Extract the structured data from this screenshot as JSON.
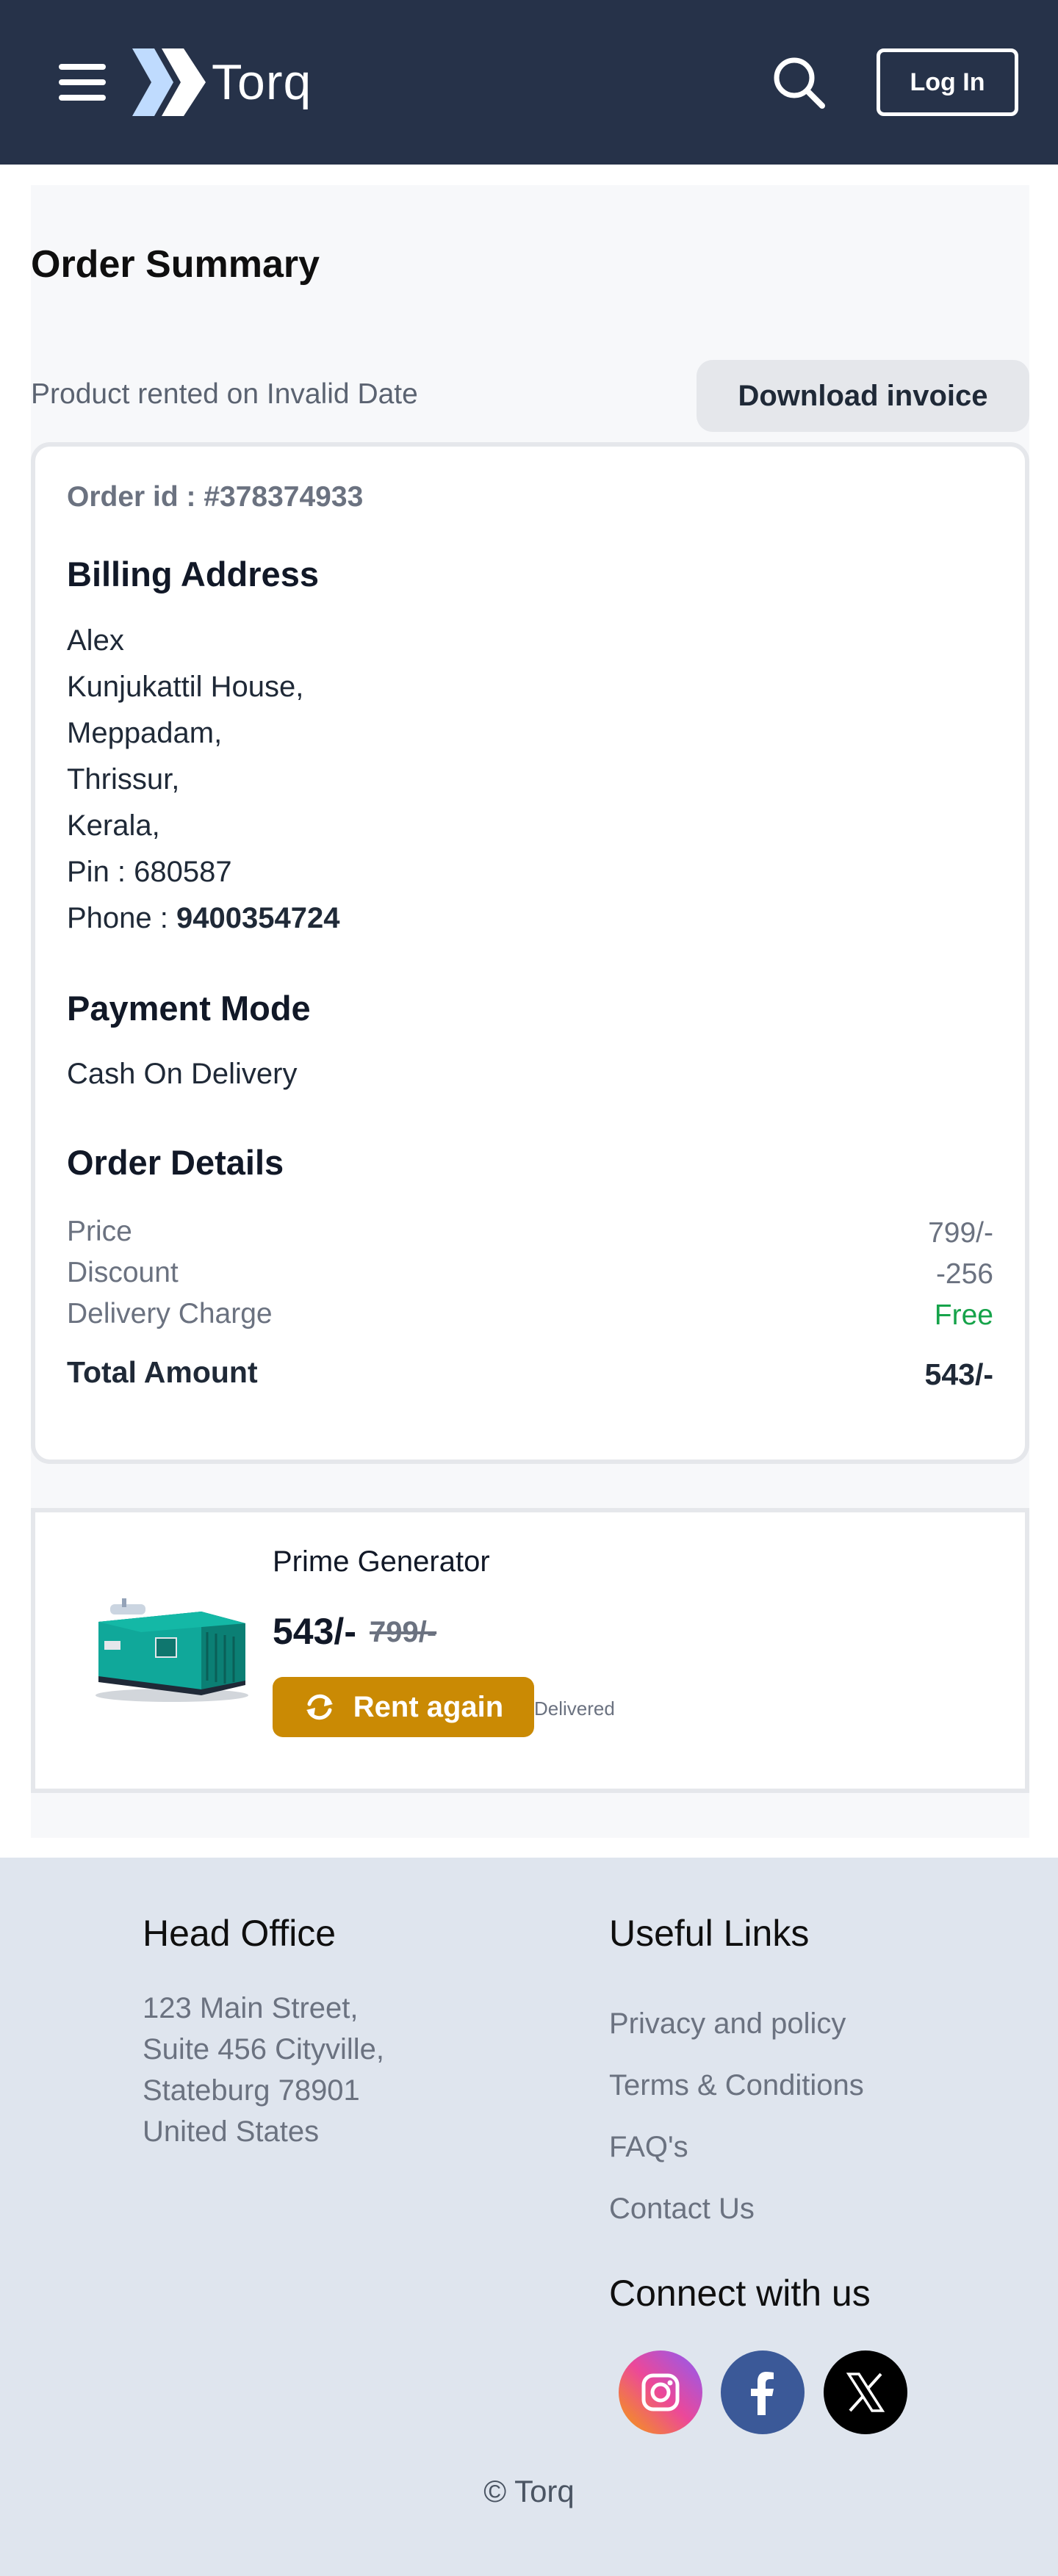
{
  "header": {
    "brand": "Torq",
    "login_label": "Log In"
  },
  "order": {
    "title": "Order Summary",
    "rented_text": "Product rented on Invalid Date",
    "download_label": "Download invoice",
    "order_id": "Order id : #378374933",
    "billing": {
      "title": "Billing Address",
      "name": "Alex",
      "line1": "Kunjukattil House,",
      "line2": "Meppadam,",
      "line3": "Thrissur,",
      "line4": "Kerala,",
      "pin": "Pin : 680587",
      "phone_label": "Phone : ",
      "phone": "9400354724"
    },
    "payment": {
      "title": "Payment Mode",
      "mode": "Cash On Delivery"
    },
    "details": {
      "title": "Order Details",
      "price_label": "Price",
      "price_value": "799/-",
      "discount_label": "Discount",
      "discount_value": "-256",
      "delivery_label": "Delivery Charge",
      "delivery_value": "Free",
      "total_label": "Total Amount",
      "total_value": "543/-"
    }
  },
  "product": {
    "name": "Prime Generator",
    "price": "543/-",
    "old_price": "799/-",
    "rent_again_label": "Rent again",
    "status": "Delivered"
  },
  "footer": {
    "head_office_title": "Head Office",
    "address_line1": "123 Main Street,",
    "address_line2": "Suite 456 Cityville,",
    "address_line3": "Stateburg 78901",
    "address_line4": "United States",
    "useful_links_title": "Useful Links",
    "link_privacy": "Privacy and policy",
    "link_terms": "Terms & Conditions",
    "link_faq": "FAQ's",
    "link_contact": "Contact Us",
    "connect_title": "Connect with us",
    "copyright": "© Torq"
  },
  "icons": {
    "menu": "hamburger-icon",
    "search": "search-icon",
    "refresh": "refresh-icon",
    "instagram": "instagram-icon",
    "facebook": "facebook-icon",
    "x": "x-icon"
  },
  "colors": {
    "header_bg": "#263249",
    "logo_accent": "#bfdbfe",
    "rent_button": "#ca8a04",
    "free_text": "#16a34a",
    "footer_bg": "#dfe5ee"
  }
}
